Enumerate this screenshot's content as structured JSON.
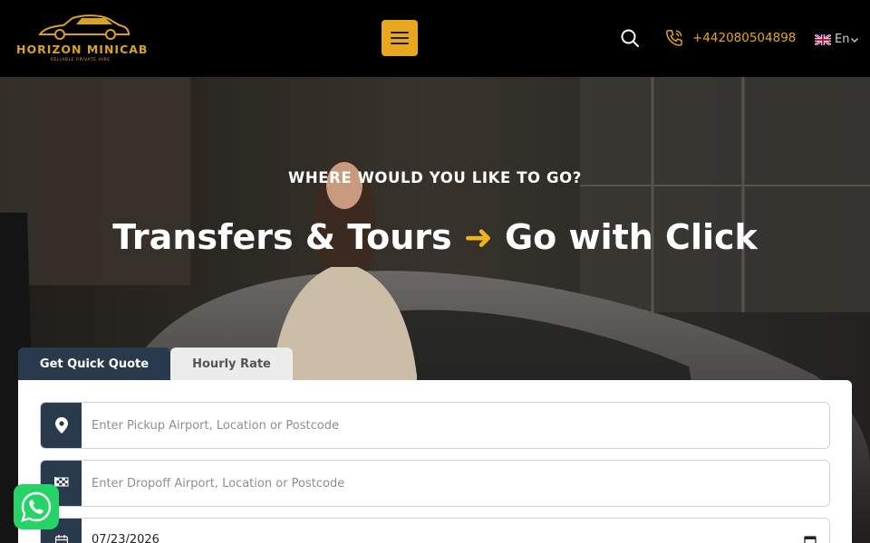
{
  "brand": {
    "name": "HORIZON MINICAB",
    "tagline": "RELIABLE PRIVATE HIRE",
    "accent": "#e8a71c",
    "dark": "#2a3a4d"
  },
  "header": {
    "menu_icon": "hamburger-icon",
    "search_icon": "search-icon",
    "phone_icon": "phone-icon",
    "phone": "+442080504898",
    "language": "En",
    "language_flag": "uk-flag-icon"
  },
  "hero": {
    "eyebrow": "WHERE WOULD YOU LIKE TO GO?",
    "headline_left": "Transfers & Tours",
    "headline_arrow": "➜",
    "headline_right": "Go with Click"
  },
  "booking": {
    "tabs": [
      {
        "label": "Get Quick Quote",
        "active": true
      },
      {
        "label": "Hourly Rate",
        "active": false
      }
    ],
    "pickup": {
      "placeholder": "Enter Pickup Airport, Location or Postcode",
      "icon": "location-pin-icon"
    },
    "dropoff": {
      "placeholder": "Enter Dropoff Airport, Location or Postcode",
      "icon": "checkered-flag-icon"
    },
    "date": {
      "value": "07/23/2026",
      "icon": "calendar-icon"
    }
  },
  "whatsapp": {
    "icon": "whatsapp-icon"
  }
}
